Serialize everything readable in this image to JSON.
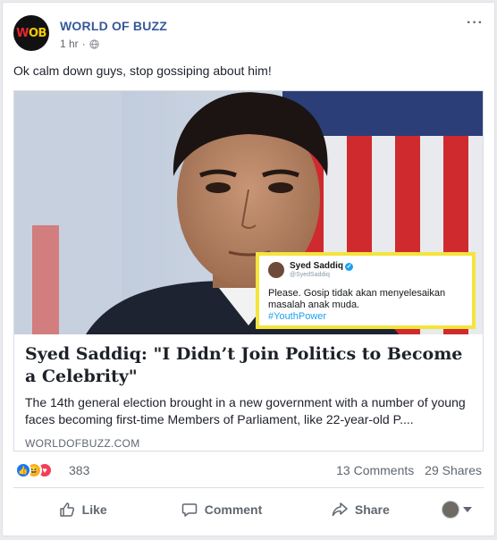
{
  "post": {
    "page_name": "WORLD OF BUZZ",
    "avatar_text_w": "W",
    "avatar_text_ob": "OB",
    "time": "1 hr",
    "separator": "·",
    "more": "···",
    "text": "Ok calm down guys, stop gossiping about him!"
  },
  "link": {
    "title": "Syed Saddiq: \"I Didn’t Join Politics to Become a Celebrity\"",
    "description": "The 14th general election brought in a new government with a number of young faces becoming first-time Members of Parliament, like 22-year-old P....",
    "domain": "WORLDOFBUZZ.COM"
  },
  "tweet": {
    "name": "Syed Saddiq",
    "handle": "@SyedSaddiq",
    "text": "Please. Gosip tidak akan menyelesaikan masalah anak muda.",
    "hashtag": "#YouthPower"
  },
  "engagement": {
    "reaction_count": "383",
    "comments": "13 Comments",
    "shares": "29 Shares"
  },
  "actions": {
    "like": "Like",
    "comment": "Comment",
    "share": "Share"
  },
  "colors": {
    "page_link": "#365899",
    "like_blue": "#1877f2",
    "haha_yellow": "#f7b125",
    "love_red": "#f33e58",
    "tweet_border": "#f4e43c"
  }
}
